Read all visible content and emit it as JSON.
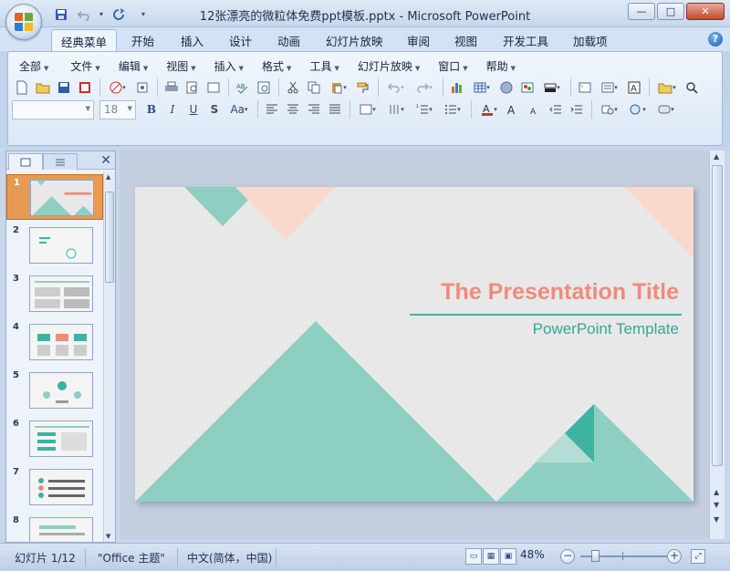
{
  "window": {
    "title": "12张漂亮的微粒体免费ppt模板.pptx - Microsoft PowerPoint",
    "controls": {
      "minimize": "—",
      "maximize": "□",
      "close": "✕"
    }
  },
  "quick_access": [
    {
      "name": "save-icon",
      "glyph": "💾"
    },
    {
      "name": "undo-icon",
      "glyph": "↶"
    },
    {
      "name": "undo-dropdown-icon",
      "glyph": "▾"
    },
    {
      "name": "redo-icon",
      "glyph": "↻"
    },
    {
      "name": "customize-qat-icon",
      "glyph": "▾"
    }
  ],
  "ribbon_tabs": [
    {
      "label": "经典菜单",
      "active": true
    },
    {
      "label": "开始"
    },
    {
      "label": "插入"
    },
    {
      "label": "设计"
    },
    {
      "label": "动画"
    },
    {
      "label": "幻灯片放映"
    },
    {
      "label": "审阅"
    },
    {
      "label": "视图"
    },
    {
      "label": "开发工具"
    },
    {
      "label": "加载项"
    }
  ],
  "help_glyph": "?",
  "classic_menu": [
    {
      "label": "全部"
    },
    {
      "label": "文件"
    },
    {
      "label": "编辑"
    },
    {
      "label": "视图"
    },
    {
      "label": "插入"
    },
    {
      "label": "格式"
    },
    {
      "label": "工具"
    },
    {
      "label": "幻灯片放映"
    },
    {
      "label": "窗口"
    },
    {
      "label": "帮助"
    }
  ],
  "toolbar1": [
    "new-doc-icon",
    "open-icon",
    "save-icon",
    "save-pdf-icon",
    "permission-icon",
    "attach-icon",
    "print-icon",
    "print-preview-icon",
    "research-icon",
    "spelling-icon",
    "check-icon",
    "cut-icon",
    "copy-icon",
    "paste-icon",
    "format-painter-icon",
    "undo-icon",
    "redo-icon",
    "chart-icon",
    "table-icon",
    "clipart-icon",
    "picture-icon",
    "shape-icon",
    "new-slide-icon",
    "layout-icon",
    "textbox-icon",
    "folder-icon",
    "zoom-icon"
  ],
  "font": {
    "name": "",
    "size": "18"
  },
  "toolbar2_glyphs": {
    "bold": "B",
    "italic": "I",
    "underline": "U",
    "shadow": "S",
    "case": "Aa"
  },
  "thumbnails": [
    {
      "num": "1",
      "selected": true
    },
    {
      "num": "2"
    },
    {
      "num": "3"
    },
    {
      "num": "4"
    },
    {
      "num": "5"
    },
    {
      "num": "6"
    },
    {
      "num": "7"
    },
    {
      "num": "8"
    }
  ],
  "slide": {
    "title": "The Presentation Title",
    "subtitle": "PowerPoint Template",
    "colors": {
      "teal": "#8ecfc3",
      "dark_teal": "#3db3a0",
      "peach": "#f9d9cb",
      "title_color": "#ef8b7d",
      "bg": "#e8e8e8"
    }
  },
  "status": {
    "slide_info": "幻灯片 1/12",
    "theme": "\"Office 主题\"",
    "language": "中文(简体，中国)",
    "zoom": "48%"
  }
}
